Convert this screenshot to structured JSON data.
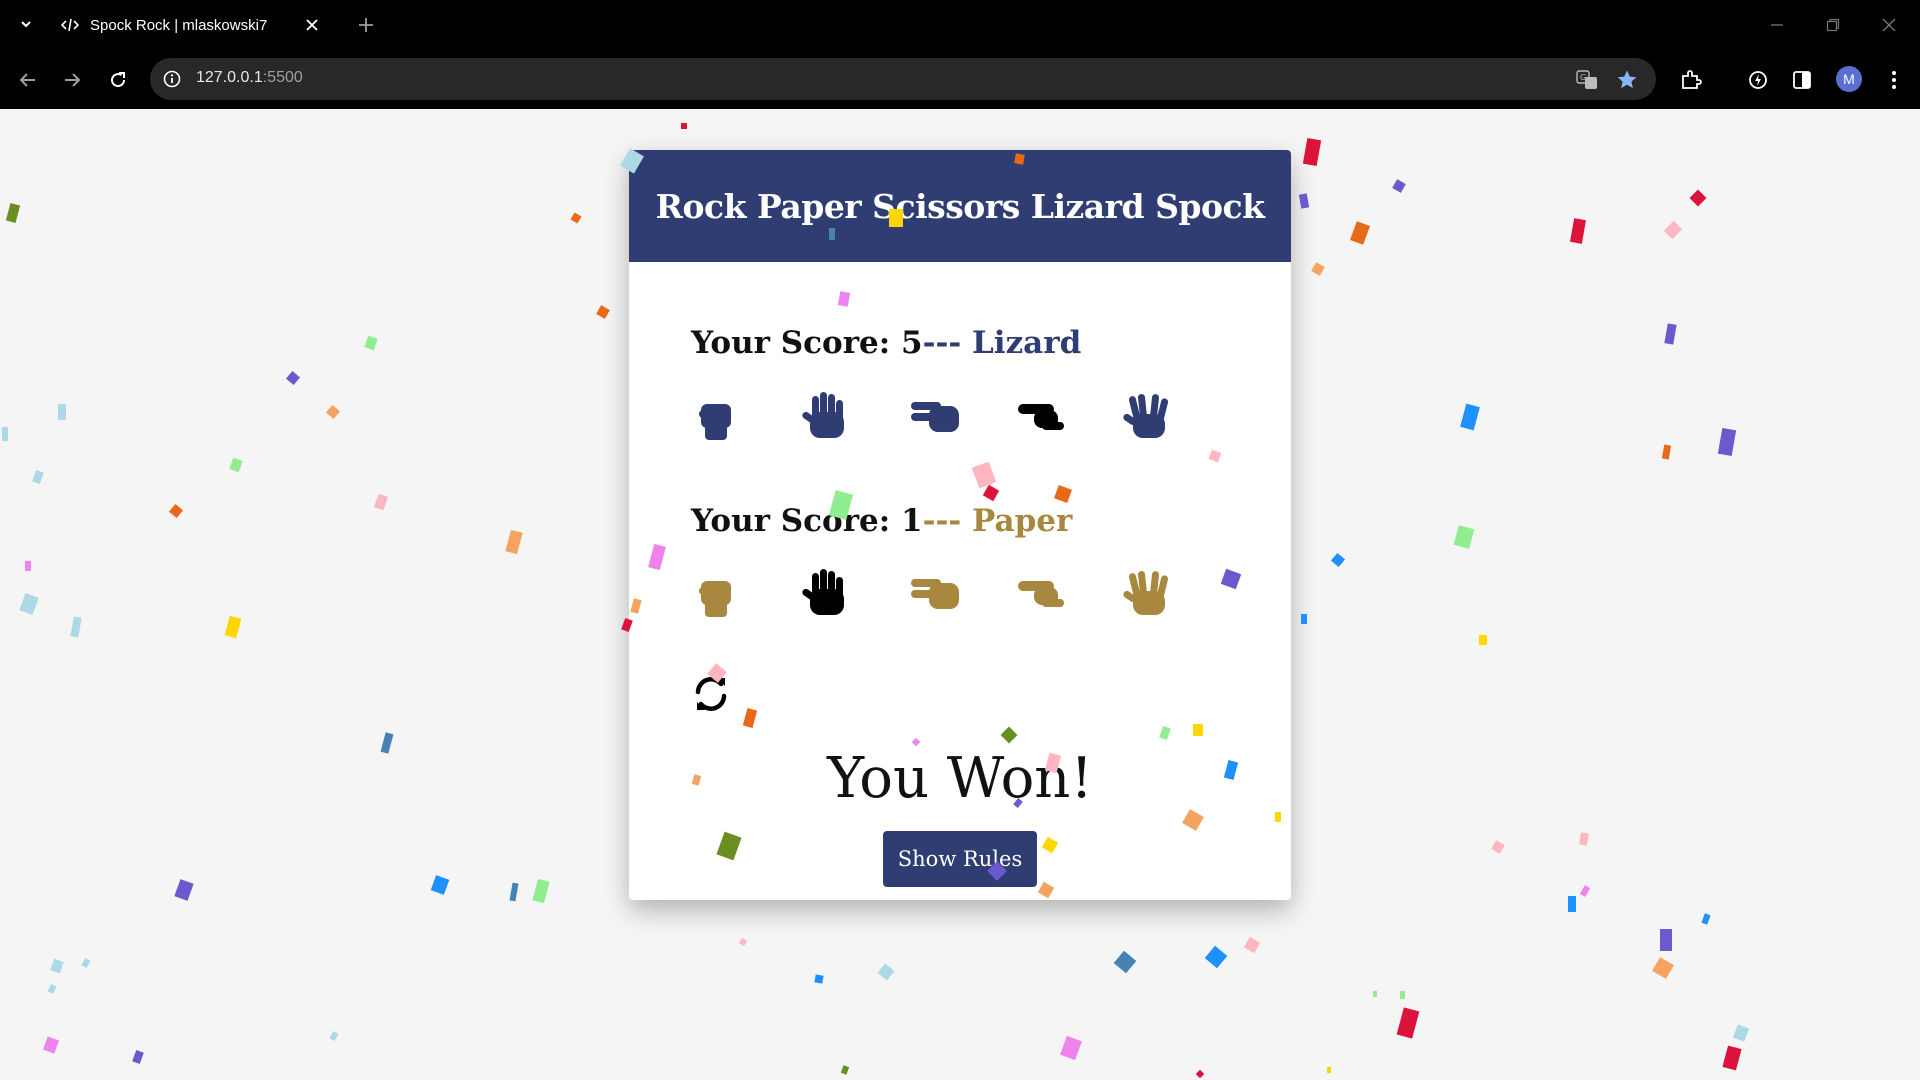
{
  "browser": {
    "tab_title": "Spock Rock | mlaskowski7",
    "url_host": "127.0.0.1",
    "url_port": ":5500",
    "profile_initial": "M"
  },
  "game": {
    "title": "Rock Paper Scissors Lizard Spock",
    "player": {
      "label": "Your Score: ",
      "score": "5",
      "separator": "--- ",
      "choice": "Lizard",
      "color": "#2f3d72",
      "selected": "lizard"
    },
    "computer": {
      "label": "Your Score: ",
      "score": "1",
      "separator": "--- ",
      "choice": "Paper",
      "color": "#a8883e",
      "selected": "paper"
    },
    "hands": [
      "rock",
      "paper",
      "scissors",
      "lizard",
      "spock"
    ],
    "result": "You Won!",
    "rules_button": "Show Rules",
    "header_color": "#2f3d72"
  }
}
